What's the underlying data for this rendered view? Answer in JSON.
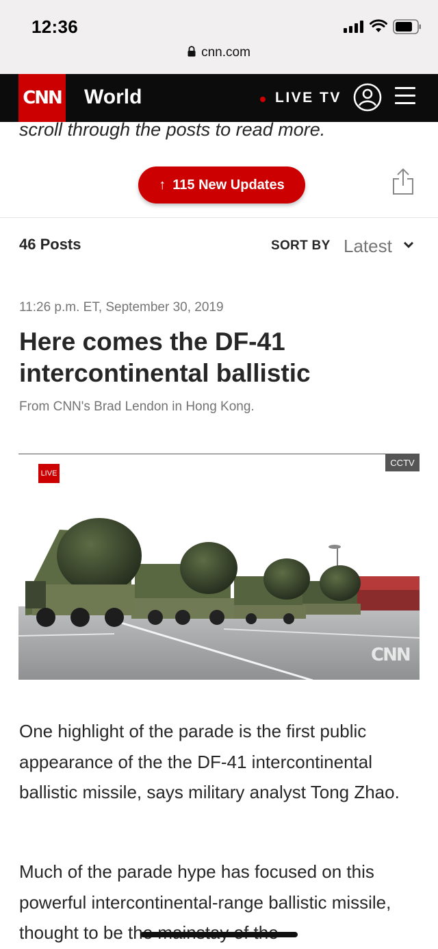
{
  "status_bar": {
    "time": "12:36",
    "url": "cnn.com"
  },
  "header": {
    "logo": "CNN",
    "section": "World",
    "live_tv": "LIVE TV",
    "icons": [
      "user-icon",
      "menu-icon"
    ]
  },
  "intro": {
    "text": "scroll through the posts to read more."
  },
  "updates_button": {
    "label": "115 New Updates",
    "icon": "arrow-up-icon"
  },
  "posts_bar": {
    "count_label": "46 Posts",
    "sort_label": "SORT BY",
    "sort_value": "Latest"
  },
  "post": {
    "timestamp": "11:26 p.m. ET, September 30, 2019",
    "headline": "Here comes the DF-41 intercontinental ballistic",
    "byline": "From CNN's Brad Lendon in Hong Kong.",
    "video": {
      "source_badge": "CCTV",
      "live_badge": "LIVE",
      "watermark": "CNN"
    },
    "paragraphs": [
      "One highlight of the parade is the first public appearance of the the DF-41 intercontinental ballistic missile, says military analyst Tong Zhao.",
      "Much of the parade hype has focused on this powerful intercontinental-range ballistic missile, thought to be the mainstay of the"
    ]
  },
  "colors": {
    "brand_red": "#cc0000",
    "header_bg": "#0c0c0c",
    "text_dark": "#262626",
    "text_muted": "#757575"
  }
}
